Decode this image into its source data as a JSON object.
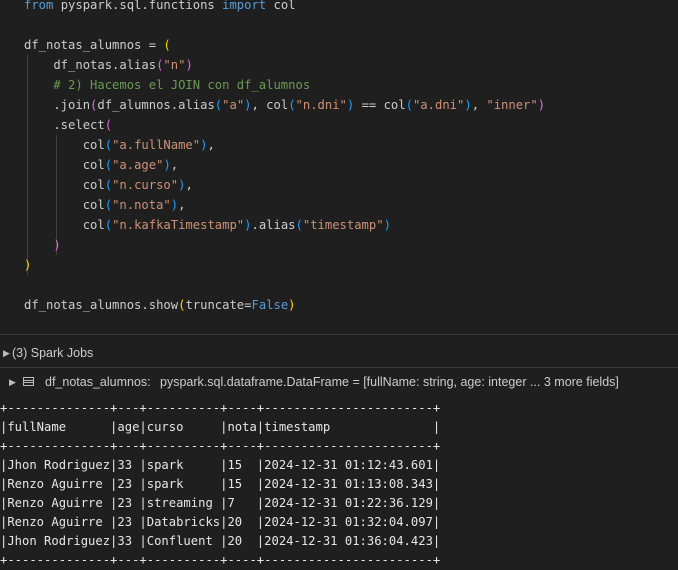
{
  "code": {
    "lines": [
      [
        {
          "t": "from ",
          "c": "kw"
        },
        {
          "t": "pyspark.sql.functions ",
          "c": ""
        },
        {
          "t": "import ",
          "c": "kw"
        },
        {
          "t": "col",
          "c": ""
        }
      ],
      [],
      [
        {
          "t": "df_notas_alumnos = ",
          "c": ""
        },
        {
          "t": "(",
          "c": "p1"
        }
      ],
      [
        {
          "t": "    df_notas.alias",
          "c": ""
        },
        {
          "t": "(",
          "c": "p2"
        },
        {
          "t": "\"n\"",
          "c": "str"
        },
        {
          "t": ")",
          "c": "p2"
        }
      ],
      [
        {
          "t": "    # 2) Hacemos el JOIN con df_alumnos",
          "c": "cm"
        }
      ],
      [
        {
          "t": "    .join",
          "c": ""
        },
        {
          "t": "(",
          "c": "p2"
        },
        {
          "t": "df_alumnos.alias",
          "c": ""
        },
        {
          "t": "(",
          "c": "p3"
        },
        {
          "t": "\"a\"",
          "c": "str"
        },
        {
          "t": ")",
          "c": "p3"
        },
        {
          "t": ", col",
          "c": ""
        },
        {
          "t": "(",
          "c": "p3"
        },
        {
          "t": "\"n.dni\"",
          "c": "str"
        },
        {
          "t": ")",
          "c": "p3"
        },
        {
          "t": " == col",
          "c": ""
        },
        {
          "t": "(",
          "c": "p3"
        },
        {
          "t": "\"a.dni\"",
          "c": "str"
        },
        {
          "t": ")",
          "c": "p3"
        },
        {
          "t": ", ",
          "c": ""
        },
        {
          "t": "\"inner\"",
          "c": "str"
        },
        {
          "t": ")",
          "c": "p2"
        }
      ],
      [
        {
          "t": "    .select",
          "c": ""
        },
        {
          "t": "(",
          "c": "p2"
        }
      ],
      [
        {
          "t": "        col",
          "c": ""
        },
        {
          "t": "(",
          "c": "p3"
        },
        {
          "t": "\"a.fullName\"",
          "c": "str"
        },
        {
          "t": ")",
          "c": "p3"
        },
        {
          "t": ",",
          "c": ""
        }
      ],
      [
        {
          "t": "        col",
          "c": ""
        },
        {
          "t": "(",
          "c": "p3"
        },
        {
          "t": "\"a.age\"",
          "c": "str"
        },
        {
          "t": ")",
          "c": "p3"
        },
        {
          "t": ",",
          "c": ""
        }
      ],
      [
        {
          "t": "        col",
          "c": ""
        },
        {
          "t": "(",
          "c": "p3"
        },
        {
          "t": "\"n.curso\"",
          "c": "str"
        },
        {
          "t": ")",
          "c": "p3"
        },
        {
          "t": ",",
          "c": ""
        }
      ],
      [
        {
          "t": "        col",
          "c": ""
        },
        {
          "t": "(",
          "c": "p3"
        },
        {
          "t": "\"n.nota\"",
          "c": "str"
        },
        {
          "t": ")",
          "c": "p3"
        },
        {
          "t": ",",
          "c": ""
        }
      ],
      [
        {
          "t": "        col",
          "c": ""
        },
        {
          "t": "(",
          "c": "p3"
        },
        {
          "t": "\"n.kafkaTimestamp\"",
          "c": "str"
        },
        {
          "t": ")",
          "c": "p3"
        },
        {
          "t": ".alias",
          "c": ""
        },
        {
          "t": "(",
          "c": "p3"
        },
        {
          "t": "\"timestamp\"",
          "c": "str"
        },
        {
          "t": ")",
          "c": "p3"
        }
      ],
      [
        {
          "t": "    ",
          "c": ""
        },
        {
          "t": ")",
          "c": "p2"
        }
      ],
      [
        {
          "t": ")",
          "c": "p1"
        }
      ],
      [],
      [
        {
          "t": "df_notas_alumnos.show",
          "c": ""
        },
        {
          "t": "(",
          "c": "p1"
        },
        {
          "t": "truncate",
          "c": ""
        },
        {
          "t": "=",
          "c": ""
        },
        {
          "t": "False",
          "c": "const"
        },
        {
          "t": ")",
          "c": "p1"
        }
      ]
    ]
  },
  "spark_jobs": {
    "label": "(3) Spark Jobs"
  },
  "dataframe": {
    "name": "df_notas_alumnos:",
    "type_text": "pyspark.sql.dataframe.DataFrame = [fullName: string, age: integer ... 3 more fields]"
  },
  "output": {
    "lines": [
      "+--------------+---+----------+----+-----------------------+",
      "|fullName      |age|curso     |nota|timestamp              |",
      "+--------------+---+----------+----+-----------------------+",
      "|Jhon Rodriguez|33 |spark     |15  |2024-12-31 01:12:43.601|",
      "|Renzo Aguirre |23 |spark     |15  |2024-12-31 01:13:08.343|",
      "|Renzo Aguirre |23 |streaming |7   |2024-12-31 01:22:36.129|",
      "|Renzo Aguirre |23 |Databricks|20  |2024-12-31 01:32:04.097|",
      "|Jhon Rodriguez|33 |Confluent |20  |2024-12-31 01:36:04.423|",
      "+--------------+---+----------+----+-----------------------+"
    ]
  }
}
